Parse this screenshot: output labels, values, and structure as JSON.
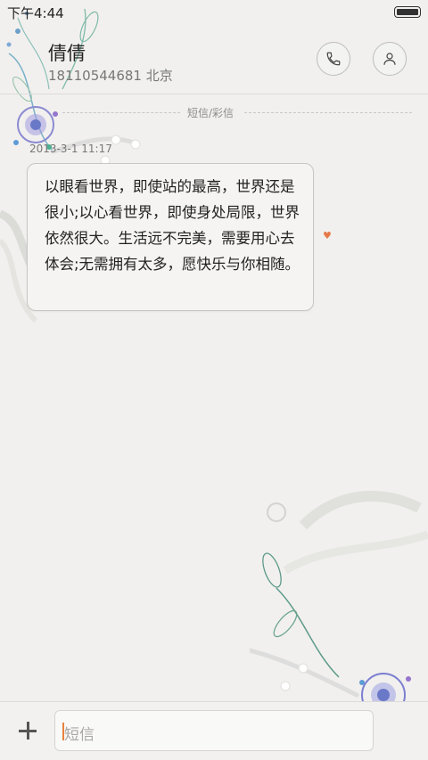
{
  "status_bar": {
    "time": "下午4:44",
    "battery_icon": "battery-icon"
  },
  "header": {
    "contact_name": "倩倩",
    "contact_detail": "18110544681 北京",
    "call_icon": "phone-icon",
    "contact_icon": "person-icon"
  },
  "conversation": {
    "section_label": "短信/彩信",
    "messages": [
      {
        "timestamp": "2013-3-1 11:17",
        "text": "以眼看世界，即使站的最高，世界还是很小;以心看世界，即使身处局限，世界依然很大。生活远不完美，需要用心去体会;无需拥有太多，愿快乐与你相随。",
        "marker_icon": "heart-icon"
      }
    ]
  },
  "input_bar": {
    "add_icon": "plus-icon",
    "placeholder": "短信"
  },
  "colors": {
    "accent": "#e57a4a",
    "background": "#f1f0ee"
  }
}
